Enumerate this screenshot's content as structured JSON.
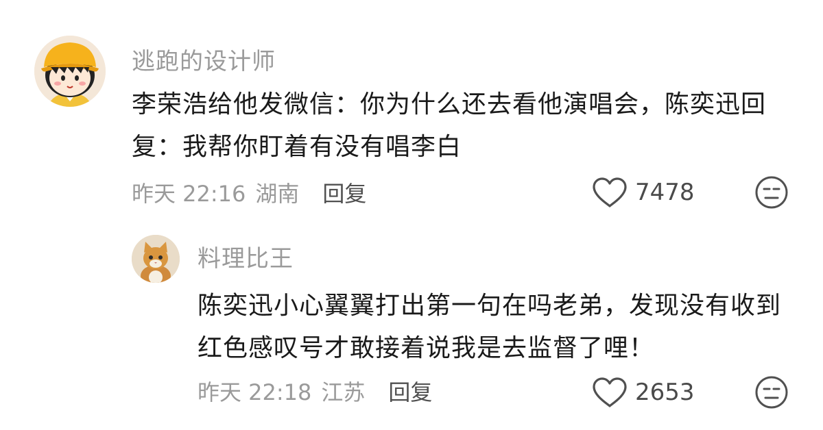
{
  "comments": [
    {
      "username": "逃跑的设计师",
      "text": "李荣浩给他发微信：你为什么还去看他演唱会，陈奕迅回复：我帮你盯着有没有唱李白",
      "time": "昨天 22:16",
      "location": "湖南",
      "reply_label": "回复",
      "likes": "7478",
      "avatar": "cartoon-girl-yellow-hat"
    }
  ],
  "reply": {
    "username": "料理比王",
    "text": "陈奕迅小心翼翼打出第一句在吗老弟，发现没有收到红色感叹号才敢接着说我是去监督了哩！",
    "time": "昨天 22:18",
    "location": "江苏",
    "reply_label": "回复",
    "likes": "2653",
    "avatar": "orange-cat"
  },
  "icons": {
    "like": "heart-outline-icon",
    "dislike": "unamused-face-icon"
  },
  "colors": {
    "username": "#9a9a9a",
    "text": "#1a1a1a",
    "meta": "#9a9a9a",
    "icon": "#505050"
  }
}
